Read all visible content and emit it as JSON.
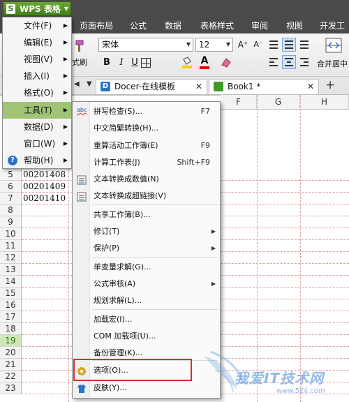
{
  "app": {
    "menu_button": "WPS 表格",
    "logo_letter": "S"
  },
  "ribbon_tabs": [
    {
      "label": "页面布局"
    },
    {
      "label": "公式"
    },
    {
      "label": "数据"
    },
    {
      "label": "表格样式"
    },
    {
      "label": "审阅"
    },
    {
      "label": "视图"
    },
    {
      "label": "开发工具"
    }
  ],
  "ribbon": {
    "font_name": "宋体",
    "font_size": "12",
    "format_painter_label": "式刷",
    "merge_label": "合并居中",
    "bold": "B",
    "italic": "I",
    "underline": "U",
    "font_color_label": "A"
  },
  "doc_tabs": [
    {
      "label": "Docer-在线模板",
      "close": "✕"
    },
    {
      "label": "Book1 *",
      "close": "✕"
    }
  ],
  "new_tab_label": "+",
  "columns": [
    "F",
    "G",
    "H"
  ],
  "rows": [
    "5",
    "6",
    "7",
    "8",
    "9",
    "10",
    "11",
    "12",
    "13",
    "14",
    "15",
    "16",
    "17",
    "18",
    "19",
    "20",
    "21",
    "22",
    "23"
  ],
  "selected_row": "19",
  "cells": [
    "00201408",
    "00201409",
    "00201410"
  ],
  "main_menu": [
    {
      "label": "文件(F)"
    },
    {
      "label": "编辑(E)"
    },
    {
      "label": "视图(V)"
    },
    {
      "label": "插入(I)"
    },
    {
      "label": "格式(O)"
    },
    {
      "label": "工具(T)",
      "highlighted": true
    },
    {
      "label": "数据(D)"
    },
    {
      "label": "窗口(W)"
    },
    {
      "label": "帮助(H)",
      "icon": "help-icon"
    }
  ],
  "tools_menu": [
    {
      "label": "拼写检查(S)...",
      "shortcut": "F7",
      "icon": "spell-check-icon",
      "icon_text": "abc"
    },
    {
      "label": "中文简繁转换(H)..."
    },
    {
      "label": "重算活动工作簿(E)",
      "shortcut": "F9"
    },
    {
      "label": "计算工作表(J)",
      "shortcut": "Shift+F9"
    },
    {
      "label": "文本转换成数值(N)",
      "icon": "convert-number-icon"
    },
    {
      "label": "文本转换成超链接(V)",
      "icon": "convert-link-icon"
    },
    {
      "label": "共享工作簿(B)..."
    },
    {
      "label": "修订(T)",
      "submenu": true
    },
    {
      "label": "保护(P)",
      "submenu": true
    },
    {
      "label": "单变量求解(G)..."
    },
    {
      "label": "公式审核(A)",
      "submenu": true
    },
    {
      "label": "规划求解(L)..."
    },
    {
      "label": "加载宏(I)..."
    },
    {
      "label": "COM 加载项(U)..."
    },
    {
      "label": "备份管理(K)..."
    },
    {
      "label": "选项(O)...",
      "icon": "gear-icon",
      "highlighted_box": true
    },
    {
      "label": "皮肤(Y)...",
      "icon": "shirt-icon"
    }
  ],
  "watermark": {
    "text": "我爱IT技术网",
    "url": "www.52ij.com"
  },
  "colors": {
    "accent_green": "#6ca634",
    "menu_highlight": "#9fc476",
    "options_box": "#d03030"
  }
}
